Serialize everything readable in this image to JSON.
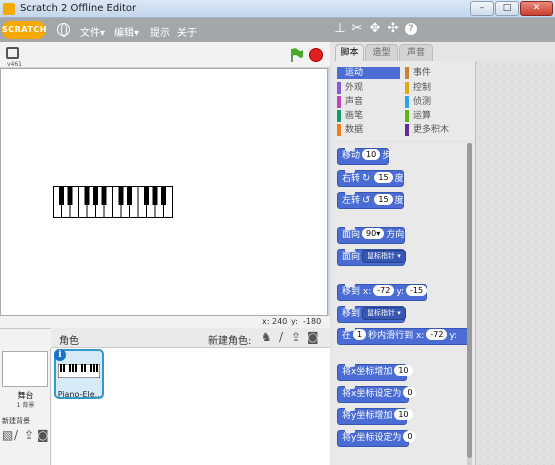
{
  "window": {
    "title": "Scratch 2 Offline Editor",
    "minimize": "–",
    "maximize": "□",
    "close": "✕"
  },
  "menubar": {
    "logo": "SCRATCH",
    "file": "文件▾",
    "edit": "编辑▾",
    "tips": "提示",
    "about": "关于",
    "tools": [
      "stamp-icon",
      "cut-icon",
      "grow-icon",
      "shrink-icon",
      "help-icon"
    ],
    "help": "?"
  },
  "stage": {
    "version": "v461",
    "coords": {
      "x_label": "x:",
      "x_value": "240",
      "y_label": "y:",
      "y_value": "-180"
    }
  },
  "sprites": {
    "header": "角色",
    "new_sprite_label": "新建角色:",
    "stage_label": "舞台",
    "backdrop_count": "1 背景",
    "new_backdrop_label": "新建背景",
    "items": [
      {
        "name": "Piano-Ele..."
      }
    ],
    "info": "i"
  },
  "tabs": {
    "scripts": "脚本",
    "costumes": "造型",
    "sounds": "声音"
  },
  "categories": [
    {
      "label": "运动",
      "color": "#4a6cd4",
      "active": true
    },
    {
      "label": "事件",
      "color": "#c88330"
    },
    {
      "label": "外观",
      "color": "#8a55d7"
    },
    {
      "label": "控制",
      "color": "#e1a91a"
    },
    {
      "label": "声音",
      "color": "#bb42c3"
    },
    {
      "label": "侦测",
      "color": "#2ca5e2"
    },
    {
      "label": "画笔",
      "color": "#0e9a6c"
    },
    {
      "label": "运算",
      "color": "#5cb712"
    },
    {
      "label": "数据",
      "color": "#ee7d16"
    },
    {
      "label": "更多积木",
      "color": "#632d99"
    }
  ],
  "blocks": {
    "move": {
      "a": "移动",
      "n": "10",
      "b": "步"
    },
    "turn_right": {
      "a": "右转",
      "icon": "↻",
      "n": "15",
      "b": "度"
    },
    "turn_left": {
      "a": "左转",
      "icon": "↺",
      "n": "15",
      "b": "度"
    },
    "point_dir": {
      "a": "面向",
      "n": "90▾",
      "b": "方向"
    },
    "point_towards": {
      "a": "面向",
      "d": "鼠标指针 ▾"
    },
    "goto_xy": {
      "a": "移到",
      "x": "x:",
      "xv": "-72",
      "y": "y:",
      "yv": "-15"
    },
    "goto": {
      "a": "移到",
      "d": "鼠标指针 ▾"
    },
    "glide": {
      "a": "在",
      "n": "1",
      "b": "秒内滑行到",
      "x": "x:",
      "xv": "-72",
      "y": "y:"
    },
    "change_x": {
      "a": "将x坐标增加",
      "n": "10"
    },
    "set_x": {
      "a": "将x坐标设定为",
      "n": "0"
    },
    "change_y": {
      "a": "将y坐标增加",
      "n": "10"
    },
    "set_y": {
      "a": "将y坐标设定为",
      "n": "0"
    }
  }
}
